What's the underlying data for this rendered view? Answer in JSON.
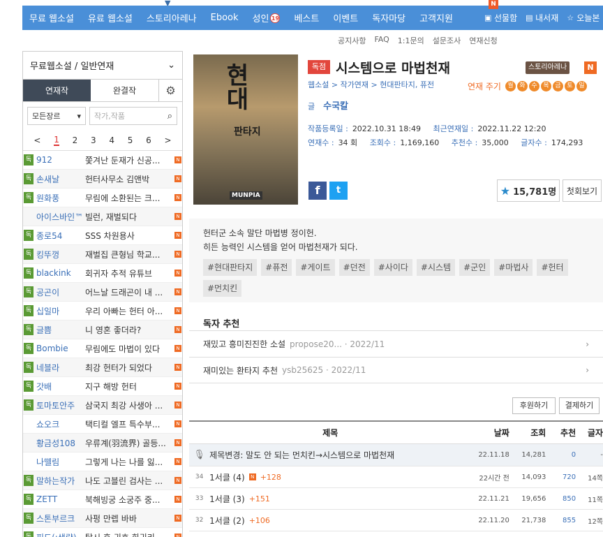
{
  "topnav": {
    "items": [
      "무료 웹소설",
      "유료 웹소설",
      "스토리아레나",
      "Ebook",
      "성인",
      "베스트",
      "이벤트",
      "독자마당",
      "고객지원"
    ],
    "adult_badge": "19",
    "right": [
      "선물함",
      "내서재",
      "오늘본"
    ],
    "n_badge": "N"
  },
  "sublinks": [
    "공지사항",
    "FAQ",
    "1:1문의",
    "설문조사",
    "연재신청"
  ],
  "sidebar": {
    "header": "무료웹소설 / 일반연재",
    "tabs": [
      "연재작",
      "완결작"
    ],
    "genre_select": "모든장르",
    "search_placeholder": "작가,작품",
    "pages": [
      "1",
      "2",
      "3",
      "4",
      "5",
      "6"
    ],
    "rows": [
      {
        "dok": "독",
        "author": "912",
        "title": "쫓겨난 둔재가 신공..."
      },
      {
        "dok": "독",
        "author": "손새날",
        "title": "헌터사무소 김앤박"
      },
      {
        "dok": "독",
        "author": "원화풍",
        "title": "무림에 소환된는 크..."
      },
      {
        "dok": "",
        "author": "아이스바인™",
        "title": "빌런, 재벌되다"
      },
      {
        "dok": "독",
        "author": "종로54",
        "title": "SSS 차원용사"
      },
      {
        "dok": "독",
        "author": "킹뚜껑",
        "title": "재벌집 큰형님 학교..."
      },
      {
        "dok": "독",
        "author": "blackink",
        "title": "회귀자 추적 유튜브"
      },
      {
        "dok": "독",
        "author": "공곤이",
        "title": "어느날 드래곤이 내 ..."
      },
      {
        "dok": "독",
        "author": "십일마",
        "title": "우리 아빠는 헌터 아..."
      },
      {
        "dok": "독",
        "author": "글쁨",
        "title": "니 영혼 좋더라?"
      },
      {
        "dok": "독",
        "author": "Bombie",
        "title": "무림에도 마법이 있다"
      },
      {
        "dok": "독",
        "author": "네블라",
        "title": "최강 헌터가 되었다"
      },
      {
        "dok": "독",
        "author": "갓배",
        "title": "지구 해방 헌터"
      },
      {
        "dok": "독",
        "author": "토마토안주",
        "title": "삼국지 최강 사생아 ..."
      },
      {
        "dok": "",
        "author": "쇼오크",
        "title": "택티컬 엘프 특수부..."
      },
      {
        "dok": "",
        "author": "황금성108",
        "title": "우류계(羽流界) 골등..."
      },
      {
        "dok": "",
        "author": "나뗄림",
        "title": "그렇게 나는 나를 잃..."
      },
      {
        "dok": "독",
        "author": "말하는작가",
        "title": "나도 고블린 검사는 ..."
      },
      {
        "dok": "독",
        "author": "ZETT",
        "title": "북해빙궁 소궁주 중..."
      },
      {
        "dok": "독",
        "author": "스톤부르크",
        "title": "사펑 만렙 바바"
      },
      {
        "dok": "독",
        "author": "피도(:생략)",
        "title": "탈시 후 귀호 회귀리"
      }
    ]
  },
  "work": {
    "cover_title": "현대판타지",
    "cover_label": "MUNPIA",
    "badge": "독점",
    "title": "시스템으로 마법천재",
    "arena": "스토리아레나",
    "n": "N",
    "crumb": "웹소설 > 작가연재 > 현대판타지, 퓨전",
    "cycle_label": "연재 주기",
    "cycle_days": [
      "월",
      "화",
      "수",
      "목",
      "금",
      "토",
      "일"
    ],
    "author_label": "글",
    "author": "수국칼",
    "reg_label": "작품등록일 :",
    "reg": "2022.10.31 18:49",
    "latest_label": "최근연재일 :",
    "latest": "2022.11.22 12:20",
    "count_label": "연재수 :",
    "count": "34 회",
    "views_label": "조회수 :",
    "views": "1,169,160",
    "rec_label": "추천수 :",
    "rec": "35,000",
    "chars_label": "글자수 :",
    "chars": "174,293",
    "stars": "15,781명",
    "first_btn": "첫회보기"
  },
  "desc": {
    "line1": "헌터군 소속 말단 마법병 정이헌.",
    "line2": "히든 능력인 시스템을 얻어 마법천재가 되다.",
    "tags": [
      "#현대판타지",
      "#퓨전",
      "#게이트",
      "#던전",
      "#사이다",
      "#시스템",
      "#군인",
      "#마법사",
      "#헌터",
      "#먼치킨"
    ]
  },
  "reader_rec": {
    "title": "독자 추천",
    "items": [
      {
        "text": "재밌고 흥미진진한 소설",
        "user": "propose20... · 2022/11"
      },
      {
        "text": "재미있는 환타지 추천",
        "user": "ysb25625 · 2022/11"
      }
    ]
  },
  "buttons": {
    "support": "후원하기",
    "pay": "결제하기"
  },
  "table": {
    "headers": [
      "제목",
      "날짜",
      "조회",
      "추천",
      "글자"
    ],
    "notice": {
      "title": "제목변경: 말도 안 되는 먼치킨→시스템으로 마법천재",
      "date": "22.11.18",
      "views": "14,281",
      "rec": "0",
      "chars": "-"
    },
    "rows": [
      {
        "no": "34",
        "title": "1서클 (4)",
        "up": "+128",
        "new": true,
        "date": "22시간 전",
        "views": "14,093",
        "rec": "720",
        "chars": "14쪽"
      },
      {
        "no": "33",
        "title": "1서클 (3)",
        "up": "+151",
        "new": false,
        "date": "22.11.21",
        "views": "19,656",
        "rec": "850",
        "chars": "11쪽"
      },
      {
        "no": "32",
        "title": "1서클 (2)",
        "up": "+106",
        "new": false,
        "date": "22.11.20",
        "views": "21,738",
        "rec": "855",
        "chars": "12쪽"
      }
    ]
  }
}
